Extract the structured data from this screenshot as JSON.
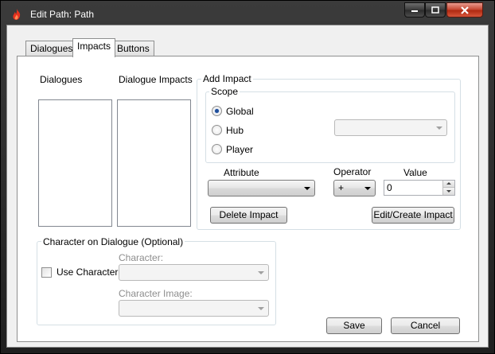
{
  "window": {
    "title": "Edit Path: Path",
    "icon": "flame-icon"
  },
  "tabs": [
    {
      "label": "Dialogues",
      "active": false
    },
    {
      "label": "Impacts",
      "active": true
    },
    {
      "label": "Buttons",
      "active": false
    }
  ],
  "impacts": {
    "dialogues_label": "Dialogues",
    "dialogue_impacts_label": "Dialogue Impacts",
    "add_impact": {
      "title": "Add Impact",
      "scope": {
        "title": "Scope",
        "options": [
          {
            "label": "Global",
            "checked": true
          },
          {
            "label": "Hub",
            "checked": false
          },
          {
            "label": "Player",
            "checked": false
          }
        ],
        "hub_select_value": ""
      },
      "attribute_label": "Attribute",
      "attribute_value": "",
      "operator_label": "Operator",
      "operator_value": "+",
      "value_label": "Value",
      "value_value": "0",
      "delete_button": "Delete Impact",
      "edit_create_button": "Edit/Create Impact"
    },
    "character": {
      "title": "Character on Dialogue (Optional)",
      "use_character_label": "Use Character",
      "use_character_checked": false,
      "character_label": "Character:",
      "character_value": "",
      "character_image_label": "Character Image:",
      "character_image_value": ""
    }
  },
  "footer": {
    "save": "Save",
    "cancel": "Cancel"
  }
}
